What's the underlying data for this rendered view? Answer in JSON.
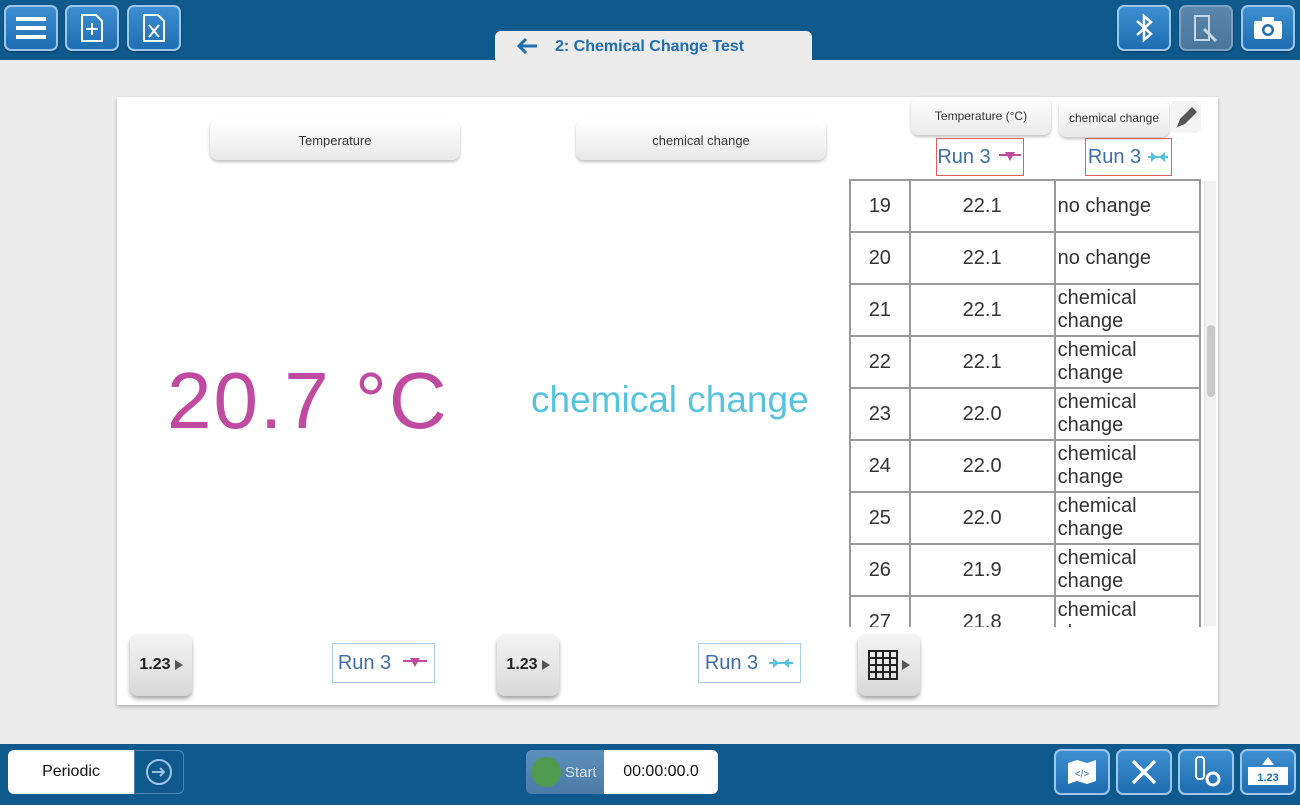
{
  "toolbar": {
    "icons": [
      "menu-icon",
      "new-file-icon",
      "excel-export-icon",
      "bluetooth-icon",
      "annotate-icon",
      "camera-icon"
    ]
  },
  "tab": {
    "title": "2: Chemical Change Test"
  },
  "panel": {
    "meter1": {
      "label": "Temperature",
      "value": "20.7 °C",
      "color": "#c04aa0"
    },
    "meter2": {
      "label": "chemical change",
      "value": "chemical change",
      "color": "#56c3de"
    },
    "table": {
      "headers": [
        "Temperature (°C)",
        "chemical change"
      ],
      "run_labels": [
        "Run 3",
        "Run 3"
      ],
      "rows": [
        [
          "19",
          "22.1",
          "no change"
        ],
        [
          "20",
          "22.1",
          "no change"
        ],
        [
          "21",
          "22.1",
          "chemical change"
        ],
        [
          "22",
          "22.1",
          "chemical change"
        ],
        [
          "23",
          "22.0",
          "chemical change"
        ],
        [
          "24",
          "22.0",
          "chemical change"
        ],
        [
          "25",
          "22.0",
          "chemical change"
        ],
        [
          "26",
          "21.9",
          "chemical change"
        ],
        [
          "27",
          "21.8",
          "chemical change"
        ]
      ]
    },
    "bottom": {
      "btn1_label": "1.23",
      "run1": "Run 3",
      "btn2_label": "1.23",
      "run2": "Run 3"
    }
  },
  "bottombar": {
    "mode": "Periodic",
    "start_label": "Start",
    "timer": "00:00:00.0",
    "meter_icon_label": "1.23"
  },
  "colors": {
    "accent": "#1f6db2",
    "bar": "#0f5a8c",
    "pink": "#c04aa0",
    "cyan": "#56c3de"
  }
}
